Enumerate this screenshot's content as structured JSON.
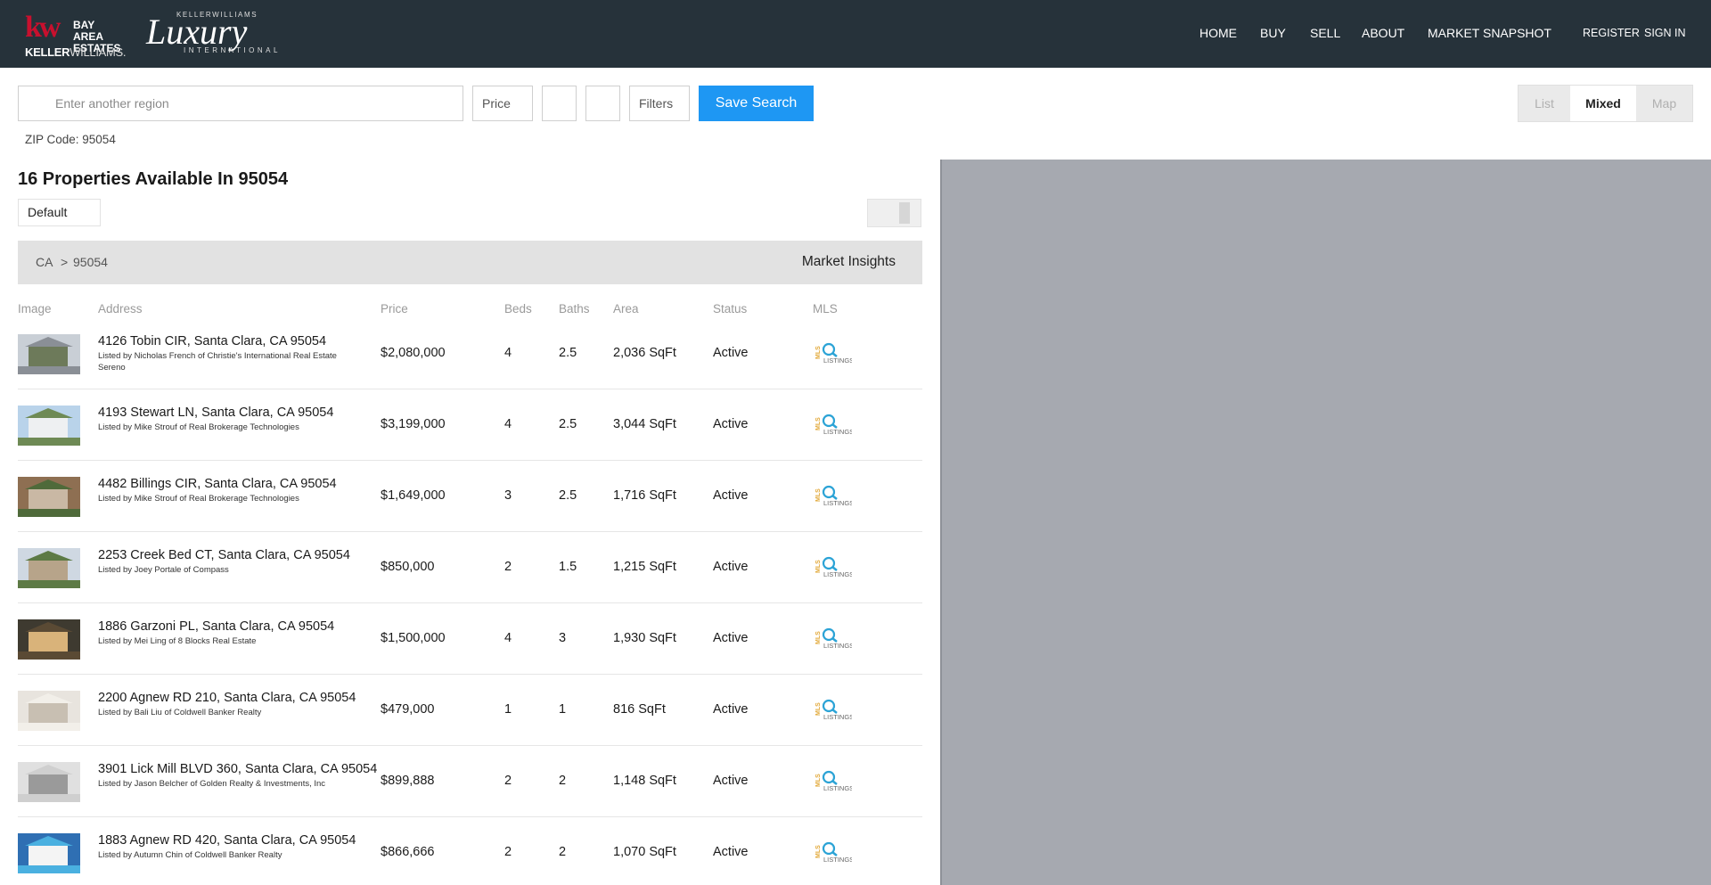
{
  "header": {
    "brand_kw": "kw",
    "brand_bay_area": "BAY AREA ESTATES",
    "brand_keller": "KELLER",
    "brand_williams": "WILLIAMS.",
    "brand_lux_top": "KELLERWILLIAMS",
    "brand_lux_word": "Luxury",
    "brand_lux_int": "INTERNATIONAL",
    "nav": [
      "HOME",
      "BUY",
      "SELL",
      "ABOUT",
      "MARKET SNAPSHOT"
    ],
    "register": "REGISTER",
    "sign_in": "SIGN IN"
  },
  "search": {
    "region_placeholder": "Enter another region",
    "price_label": "Price",
    "beds_value": "",
    "baths_value": "",
    "filters_label": "Filters",
    "save_label": "Save Search",
    "zip_label": "ZIP Code: 95054"
  },
  "views": {
    "list": "List",
    "mixed": "Mixed",
    "map": "Map",
    "active": "Mixed"
  },
  "results": {
    "title": "16 Properties Available In 95054",
    "sort": "Default",
    "breadcrumb": [
      "CA",
      ">",
      "95054"
    ],
    "insights": "Market Insights",
    "columns": [
      "Image",
      "Address",
      "Price",
      "Beds",
      "Baths",
      "Area",
      "Status",
      "MLS"
    ],
    "rows": [
      {
        "address": "4126 Tobin CIR, Santa Clara, CA 95054",
        "listed": "Listed by Nicholas French of Christie's International Real Estate Sereno",
        "price": "$2,080,000",
        "beds": "4",
        "baths": "2.5",
        "area": "2,036 SqFt",
        "status": "Active"
      },
      {
        "address": "4193 Stewart LN, Santa Clara, CA 95054",
        "listed": "Listed by Mike Strouf of Real Brokerage Technologies",
        "price": "$3,199,000",
        "beds": "4",
        "baths": "2.5",
        "area": "3,044 SqFt",
        "status": "Active"
      },
      {
        "address": "4482 Billings CIR, Santa Clara, CA 95054",
        "listed": "Listed by Mike Strouf of Real Brokerage Technologies",
        "price": "$1,649,000",
        "beds": "3",
        "baths": "2.5",
        "area": "1,716 SqFt",
        "status": "Active"
      },
      {
        "address": "2253 Creek Bed CT, Santa Clara, CA 95054",
        "listed": "Listed by Joey Portale of Compass",
        "price": "$850,000",
        "beds": "2",
        "baths": "1.5",
        "area": "1,215 SqFt",
        "status": "Active"
      },
      {
        "address": "1886 Garzoni PL, Santa Clara, CA 95054",
        "listed": "Listed by Mei Ling of 8 Blocks Real Estate",
        "price": "$1,500,000",
        "beds": "4",
        "baths": "3",
        "area": "1,930 SqFt",
        "status": "Active"
      },
      {
        "address": "2200 Agnew RD 210, Santa Clara, CA 95054",
        "listed": "Listed by Bali Liu of Coldwell Banker Realty",
        "price": "$479,000",
        "beds": "1",
        "baths": "1",
        "area": "816 SqFt",
        "status": "Active"
      },
      {
        "address": "3901 Lick Mill BLVD 360, Santa Clara, CA 95054",
        "listed": "Listed by Jason Belcher of Golden Realty & Investments, Inc",
        "price": "$899,888",
        "beds": "2",
        "baths": "2",
        "area": "1,148 SqFt",
        "status": "Active"
      },
      {
        "address": "1883 Agnew RD 420, Santa Clara, CA 95054",
        "listed": "Listed by Autumn Chin of Coldwell Banker Realty",
        "price": "$866,666",
        "beds": "2",
        "baths": "2",
        "area": "1,070 SqFt",
        "status": "Active"
      }
    ]
  },
  "mls": {
    "letters": "MLS",
    "word": "LISTINGS"
  },
  "colors": {
    "header_bg": "#26323a",
    "save_btn": "#1e97f3",
    "map_bg": "#a6a9b0",
    "kw_red": "#c8102e",
    "mls_gold": "#e2a93a",
    "mls_blue": "#2ba3d6"
  }
}
